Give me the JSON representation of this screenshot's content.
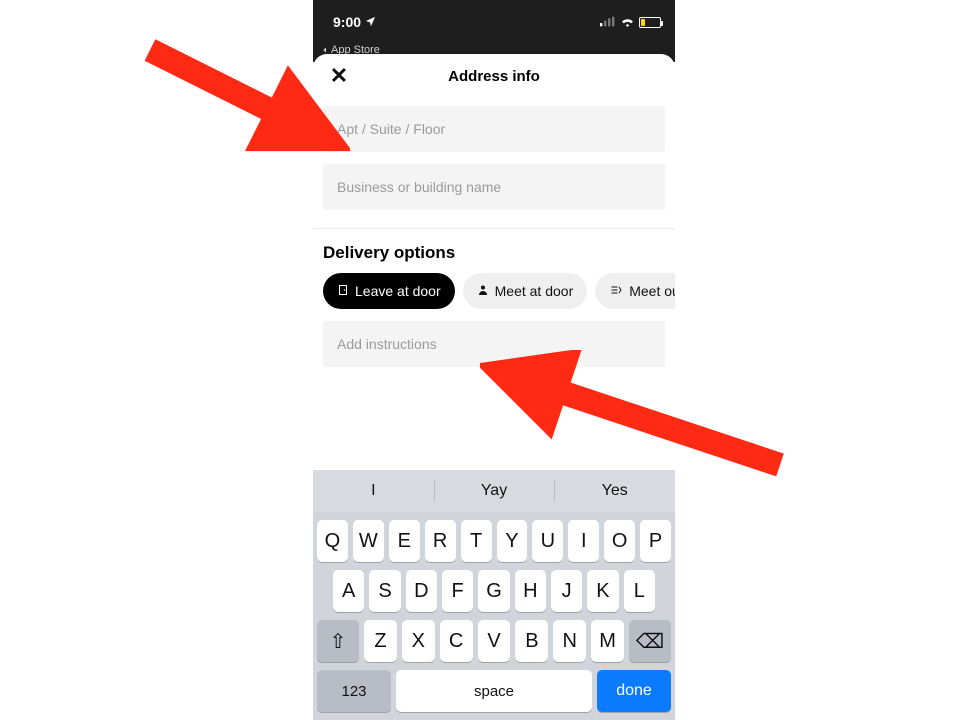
{
  "status": {
    "time": "9:00",
    "back_label": "App Store"
  },
  "sheet": {
    "title": "Address info",
    "close_label": "✕"
  },
  "fields": {
    "apt_placeholder": "Apt / Suite / Floor",
    "business_placeholder": "Business or building name",
    "instructions_placeholder": "Add instructions"
  },
  "delivery": {
    "section_title": "Delivery options",
    "options": [
      {
        "icon": "door-icon",
        "glyph": "▢",
        "label": "Leave at door",
        "selected": true
      },
      {
        "icon": "person-icon",
        "glyph": "👤",
        "label": "Meet at door",
        "selected": false
      },
      {
        "icon": "outside-icon",
        "glyph": "➜",
        "label": "Meet ou",
        "selected": false
      }
    ]
  },
  "keyboard": {
    "suggestions": [
      "I",
      "Yay",
      "Yes"
    ],
    "row1": [
      "Q",
      "W",
      "E",
      "R",
      "T",
      "Y",
      "U",
      "I",
      "O",
      "P"
    ],
    "row2": [
      "A",
      "S",
      "D",
      "F",
      "G",
      "H",
      "J",
      "K",
      "L"
    ],
    "row3": [
      "Z",
      "X",
      "C",
      "V",
      "B",
      "N",
      "M"
    ],
    "shift_glyph": "⇧",
    "backspace_glyph": "⌫",
    "numbers_label": "123",
    "space_label": "space",
    "done_label": "done"
  },
  "annotation": {
    "arrow_color": "#ff2a13"
  }
}
